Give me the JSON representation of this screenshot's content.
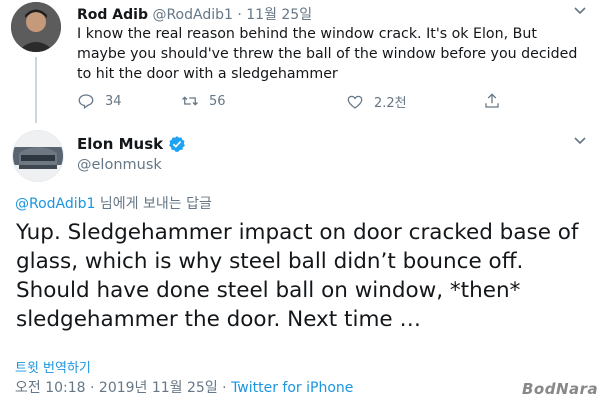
{
  "reply_tweet": {
    "display_name": "Rod Adib",
    "handle": "@RodAdib1",
    "separator": "·",
    "date": "11월 25일",
    "text": "I know the real reason behind the window crack. It's ok Elon, But maybe you should've threw the ball of the window before you decided to hit the door with a sledgehammer",
    "actions": {
      "reply_count": "34",
      "retweet_count": "56",
      "like_count": "2.2천"
    }
  },
  "main_tweet": {
    "display_name": "Elon Musk",
    "handle": "@elonmusk",
    "replying_to_mention": "@RodAdib1",
    "replying_to_suffix": " 님에게 보내는 답글",
    "text": "Yup. Sledgehammer impact on door cracked base of glass, which is why steel ball didn’t bounce off. Should have done steel ball on window, *then* sledgehammer the door. Next time …",
    "translate_label": "트윗 번역하기",
    "time_date": "오전 10:18 · 2019년 11월 25일 · ",
    "source": "Twitter for iPhone"
  },
  "watermark": "BodNara",
  "colors": {
    "accent": "#1b95e0",
    "muted": "#657786",
    "text": "#14171a",
    "verified": "#1da1f2"
  }
}
